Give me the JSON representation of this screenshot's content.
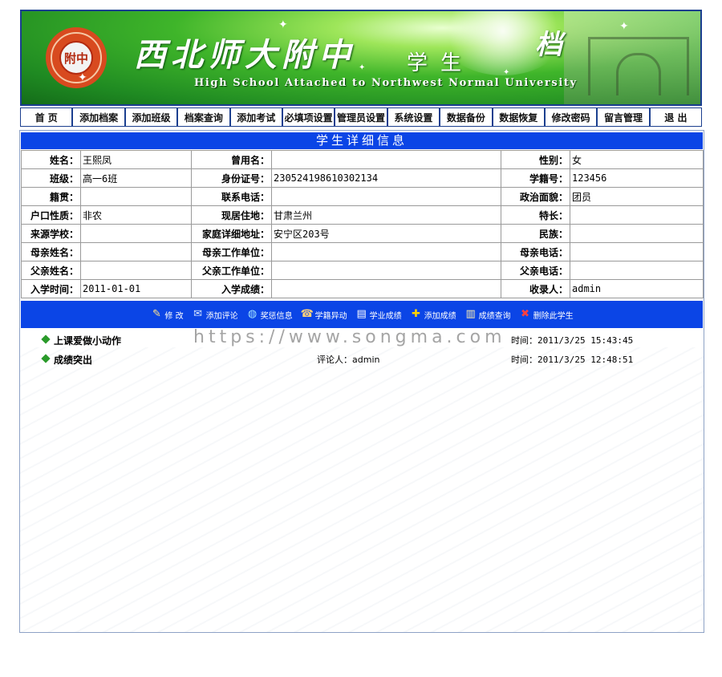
{
  "banner": {
    "title_cn": "西北师大附中",
    "subtitle": "学生",
    "subtitle_end": "档",
    "title_en": "High School Attached to Northwest Normal University",
    "logo_text": "附中"
  },
  "nav": {
    "items": [
      {
        "label": "首 页"
      },
      {
        "label": "添加档案"
      },
      {
        "label": "添加班级"
      },
      {
        "label": "档案查询"
      },
      {
        "label": "添加考试"
      },
      {
        "label": "必填项设置"
      },
      {
        "label": "管理员设置"
      },
      {
        "label": "系统设置"
      },
      {
        "label": "数据备份"
      },
      {
        "label": "数据恢复"
      },
      {
        "label": "修改密码"
      },
      {
        "label": "留言管理"
      },
      {
        "label": "退 出"
      }
    ]
  },
  "detail": {
    "header": "学生详细信息",
    "rows": [
      [
        {
          "l": "姓名：",
          "v": "王熙凤"
        },
        {
          "l": "曾用名：",
          "v": ""
        },
        {
          "l": "性别：",
          "v": "女"
        }
      ],
      [
        {
          "l": "班级：",
          "v": "高一6班"
        },
        {
          "l": "身份证号：",
          "v": "230524198610302134"
        },
        {
          "l": "学籍号：",
          "v": "123456"
        }
      ],
      [
        {
          "l": "籍贯：",
          "v": ""
        },
        {
          "l": "联系电话：",
          "v": ""
        },
        {
          "l": "政治面貌：",
          "v": "团员"
        }
      ],
      [
        {
          "l": "户口性质：",
          "v": "非农"
        },
        {
          "l": "现居住地：",
          "v": "甘肃兰州"
        },
        {
          "l": "特长：",
          "v": ""
        }
      ],
      [
        {
          "l": "来源学校：",
          "v": ""
        },
        {
          "l": "家庭详细地址：",
          "v": "安宁区203号"
        },
        {
          "l": "民族：",
          "v": ""
        }
      ],
      [
        {
          "l": "母亲姓名：",
          "v": ""
        },
        {
          "l": "母亲工作单位：",
          "v": ""
        },
        {
          "l": "母亲电话：",
          "v": ""
        }
      ],
      [
        {
          "l": "父亲姓名：",
          "v": ""
        },
        {
          "l": "父亲工作单位：",
          "v": ""
        },
        {
          "l": "父亲电话：",
          "v": ""
        }
      ],
      [
        {
          "l": "入学时间：",
          "v": "2011-01-01"
        },
        {
          "l": "入学成绩：",
          "v": ""
        },
        {
          "l": "收录人：",
          "v": "admin"
        }
      ]
    ]
  },
  "actions": [
    {
      "label": "修 改",
      "icon": "edit-icon",
      "glyph": "✎",
      "color": "#ffe48a"
    },
    {
      "label": "添加评论",
      "icon": "comment-icon",
      "glyph": "✉",
      "color": "#d8e8ff"
    },
    {
      "label": "奖惩信息",
      "icon": "award-icon",
      "glyph": "◍",
      "color": "#9fe0ff"
    },
    {
      "label": "学籍异动",
      "icon": "transfer-icon",
      "glyph": "☎",
      "color": "#ffd27a"
    },
    {
      "label": "学业成绩",
      "icon": "grades-icon",
      "glyph": "▤",
      "color": "#ffffff"
    },
    {
      "label": "添加成绩",
      "icon": "add-grade-icon",
      "glyph": "✚",
      "color": "#ffd400"
    },
    {
      "label": "成绩查询",
      "icon": "book-icon",
      "glyph": "▥",
      "color": "#fff1b0"
    },
    {
      "label": "删除此学生",
      "icon": "delete-icon",
      "glyph": "✖",
      "color": "#ff4040"
    }
  ],
  "comments": [
    {
      "title": "上课爱做小动作",
      "user": "",
      "time": "时间：2011/3/25 15:43:45"
    },
    {
      "title": "成绩突出",
      "user": "评论人：admin",
      "time": "时间：2011/3/25 12:48:51"
    }
  ],
  "watermark": "https://www.songma.com"
}
